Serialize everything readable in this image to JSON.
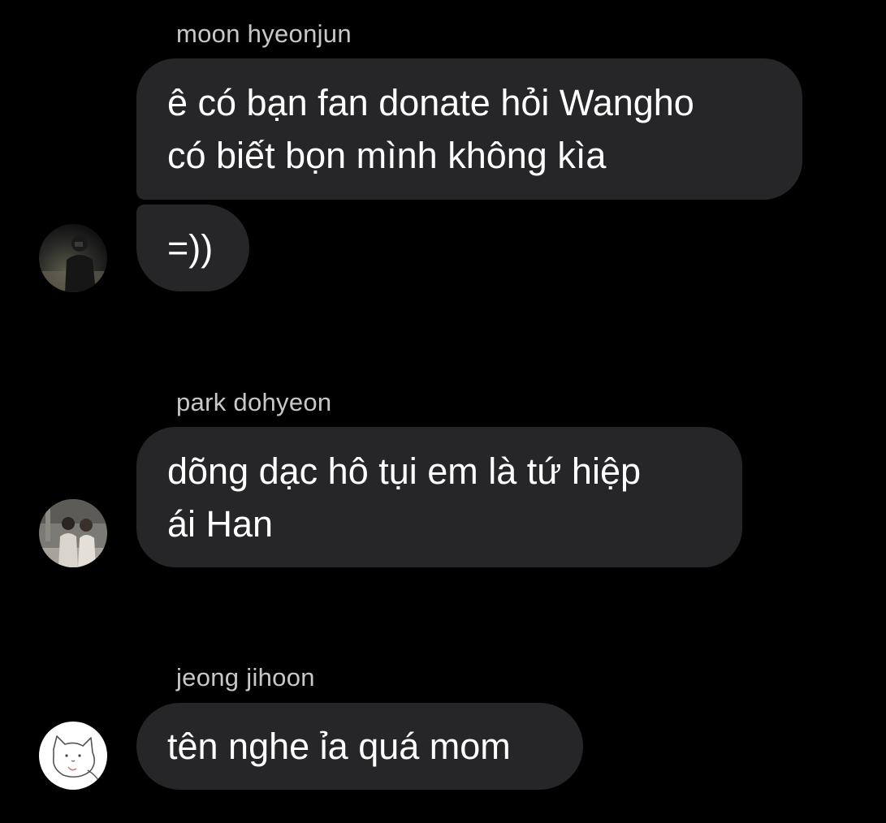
{
  "messages": [
    {
      "sender": "moon hyeonjun",
      "bubbles": [
        {
          "lines": [
            "ê có bạn fan donate hỏi Wangho",
            "có biết bọn mình không kìa"
          ]
        },
        {
          "lines": [
            "=))"
          ]
        }
      ],
      "avatar_icon": "dark-silhouette-photo-avatar-icon"
    },
    {
      "sender": "park dohyeon",
      "bubbles": [
        {
          "lines": [
            "dõng dạc hô tụi em là tứ hiệp",
            "ái Han"
          ]
        }
      ],
      "avatar_icon": "two-people-photo-avatar-icon"
    },
    {
      "sender": "jeong jihoon",
      "bubbles": [
        {
          "lines": [
            "tên nghe ỉa quá mom"
          ]
        }
      ],
      "avatar_icon": "white-cat-doodle-avatar-icon"
    }
  ],
  "colors": {
    "background": "#000000",
    "bubble": "#262628",
    "sender_text": "#c8c8c8",
    "message_text": "#ffffff"
  }
}
